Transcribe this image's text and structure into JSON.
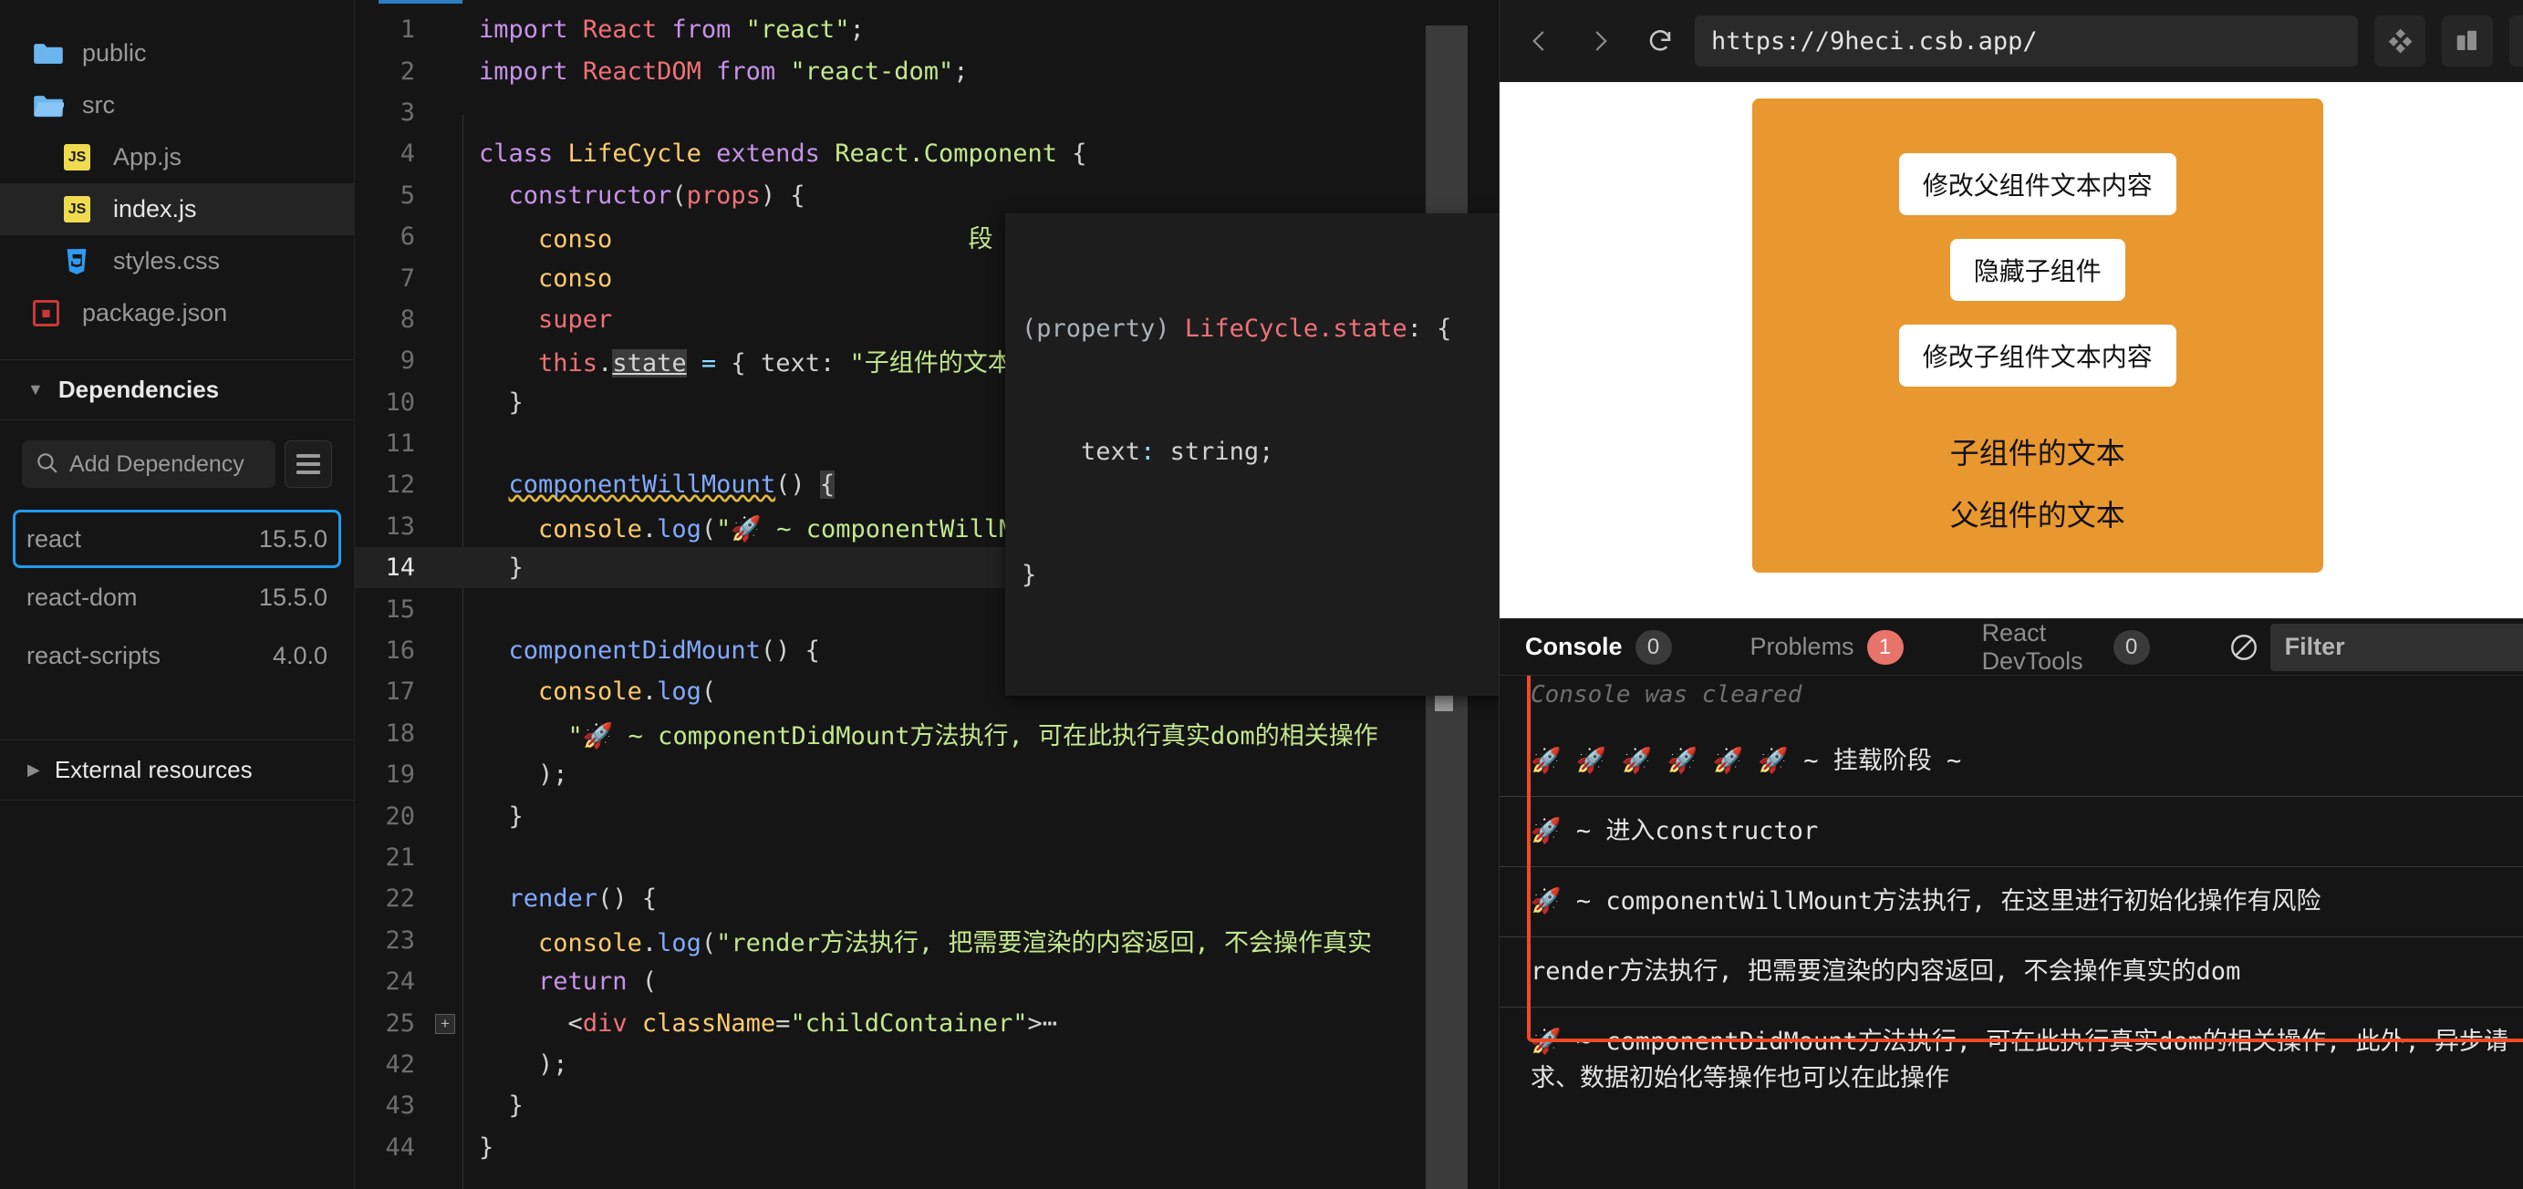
{
  "sidebar": {
    "files": [
      {
        "name": "public",
        "icon": "folder-closed-icon",
        "indent": false,
        "active": false
      },
      {
        "name": "src",
        "icon": "folder-open-icon",
        "indent": false,
        "active": false
      },
      {
        "name": "App.js",
        "icon": "js-file-icon",
        "indent": true,
        "active": false
      },
      {
        "name": "index.js",
        "icon": "js-file-icon",
        "indent": true,
        "active": true
      },
      {
        "name": "styles.css",
        "icon": "css-file-icon",
        "indent": true,
        "active": false
      },
      {
        "name": "package.json",
        "icon": "npm-file-icon",
        "indent": false,
        "active": false
      }
    ],
    "dependencies_title": "Dependencies",
    "search_placeholder": "Add Dependency",
    "dependencies": [
      {
        "name": "react",
        "version": "15.5.0",
        "selected": true
      },
      {
        "name": "react-dom",
        "version": "15.5.0",
        "selected": false
      },
      {
        "name": "react-scripts",
        "version": "4.0.0",
        "selected": false
      }
    ],
    "external_resources_title": "External resources"
  },
  "editor": {
    "current_line": 14,
    "lines": [
      {
        "n": "1",
        "html": "<span class='kw'>import</span> <span class='id'>React</span> <span class='kw'>from</span> <span class='str'>\"react\"</span><span class='punc'>;</span>"
      },
      {
        "n": "2",
        "html": "<span class='kw'>import</span> <span class='id'>ReactDOM</span> <span class='kw'>from</span> <span class='str'>\"react-dom\"</span><span class='punc'>;</span>"
      },
      {
        "n": "3",
        "html": ""
      },
      {
        "n": "4",
        "html": "<span class='kw'>class</span> <span class='cls'>LifeCycle</span> <span class='kw'>extends</span> <span class='str'>React.Component</span> <span class='punc'>{</span>"
      },
      {
        "n": "5",
        "html": "  <span class='kw'>constructor</span><span class='punc'>(</span><span class='id'>props</span><span class='punc'>) {</span>"
      },
      {
        "n": "6",
        "html": "    <span class='meth'>conso</span>                        <span class='str'>段 ~ \"</span><span class='punc'>);</span>"
      },
      {
        "n": "7",
        "html": "    <span class='meth'>conso</span>"
      },
      {
        "n": "8",
        "html": "    <span class='id'>super</span>"
      },
      {
        "n": "9",
        "html": "    <span class='id'>this</span><span class='punc'>.</span><span class='hoverword'>state</span> <span class='op'>=</span> <span class='punc'>{</span> <span class='punc'>text:</span> <span class='str'>\"子组件的文本\"</span> <span class='punc'>};</span>"
      },
      {
        "n": "10",
        "html": "  <span class='punc'>}</span>"
      },
      {
        "n": "11",
        "html": ""
      },
      {
        "n": "12",
        "html": "  <span class='fn wavy'>componentWillMount</span><span class='punc'>() </span><span class='punc cursor-sq'>{</span>"
      },
      {
        "n": "13",
        "html": "    <span class='meth'>console</span><span class='punc'>.</span><span class='fn'>log</span><span class='punc'>(</span><span class='str'>\"🚀 ~ componentWillMount方法执行, 在这里进行初始</span>"
      },
      {
        "n": "14",
        "html": "  <span class='punc'>}</span>"
      },
      {
        "n": "15",
        "html": ""
      },
      {
        "n": "16",
        "html": "  <span class='fn'>componentDidMount</span><span class='punc'>() {</span>"
      },
      {
        "n": "17",
        "html": "    <span class='meth'>console</span><span class='punc'>.</span><span class='fn'>log</span><span class='punc'>(</span>"
      },
      {
        "n": "18",
        "html": "      <span class='str'>\"🚀 ~ componentDidMount方法执行, 可在此执行真实dom的相关操作</span>"
      },
      {
        "n": "19",
        "html": "    <span class='punc'>);</span>"
      },
      {
        "n": "20",
        "html": "  <span class='punc'>}</span>"
      },
      {
        "n": "21",
        "html": ""
      },
      {
        "n": "22",
        "html": "  <span class='fn'>render</span><span class='punc'>() {</span>"
      },
      {
        "n": "23",
        "html": "    <span class='meth'>console</span><span class='punc'>.</span><span class='fn'>log</span><span class='punc'>(</span><span class='str'>\"render方法执行, 把需要渲染的内容返回, 不会操作真实</span>"
      },
      {
        "n": "24",
        "html": "    <span class='kw'>return</span> <span class='punc'>(</span>"
      },
      {
        "n": "25",
        "html": "      <span class='punc'>&lt;</span><span class='tag'>div</span> <span class='attr'>className</span><span class='punc'>=</span><span class='str'>\"childContainer\"</span><span class='punc'>&gt;</span><span class='punc'>⋯</span>",
        "fold": "+"
      },
      {
        "n": "42",
        "html": "    <span class='punc'>);</span>"
      },
      {
        "n": "43",
        "html": "  <span class='punc'>}</span>"
      },
      {
        "n": "44",
        "html": "<span class='punc'>}</span>"
      }
    ],
    "tooltip": {
      "line1_html": "<span style='color:#a9b2b8'>(property) </span><span style='color:#f07178'>LifeCycle.state</span><span style='color:#cfd2d1'>: {</span>",
      "line2_html": "    <span style='color:#cfd2d1'>text</span><span style='color:#89ddff'>:</span> <span style='color:#cfd2d1'>string;</span>",
      "line3_html": "<span style='color:#cfd2d1'>}</span>"
    }
  },
  "browser": {
    "back_icon": "chevron-left-icon",
    "forward_icon": "chevron-right-icon",
    "reload_icon": "reload-icon",
    "url": "https://9heci.csb.app/",
    "tools": [
      "sandbox-icon",
      "split-view-icon",
      "new-window-icon"
    ]
  },
  "preview": {
    "accent_color": "#e8982f",
    "buttons": [
      "修改父组件文本内容",
      "隐藏子组件",
      "修改子组件文本内容"
    ],
    "texts": [
      "子组件的文本",
      "父组件的文本"
    ]
  },
  "console": {
    "tabs": [
      {
        "label": "Console",
        "count": "0",
        "active": true,
        "warn": false
      },
      {
        "label": "Problems",
        "count": "1",
        "active": false,
        "warn": true
      },
      {
        "label": "React DevTools",
        "count": "0",
        "active": false,
        "warn": false
      }
    ],
    "clear_icon": "clear-console-icon",
    "filter_placeholder": "Filter",
    "collapse_icon": "chevron-down-icon",
    "cleared_note": "Console was cleared",
    "highlight_color": "#f04a24",
    "logs": [
      "🚀 🚀 🚀 🚀 🚀 🚀 ~ 挂载阶段 ~",
      "🚀 ~ 进入constructor",
      "🚀 ~ componentWillMount方法执行, 在这里进行初始化操作有风险",
      "render方法执行, 把需要渲染的内容返回, 不会操作真实的dom",
      "🚀 ~ componentDidMount方法执行, 可在此执行真实dom的相关操作, 此外, 异步请求、数据初始化等操作也可以在此操作"
    ]
  }
}
